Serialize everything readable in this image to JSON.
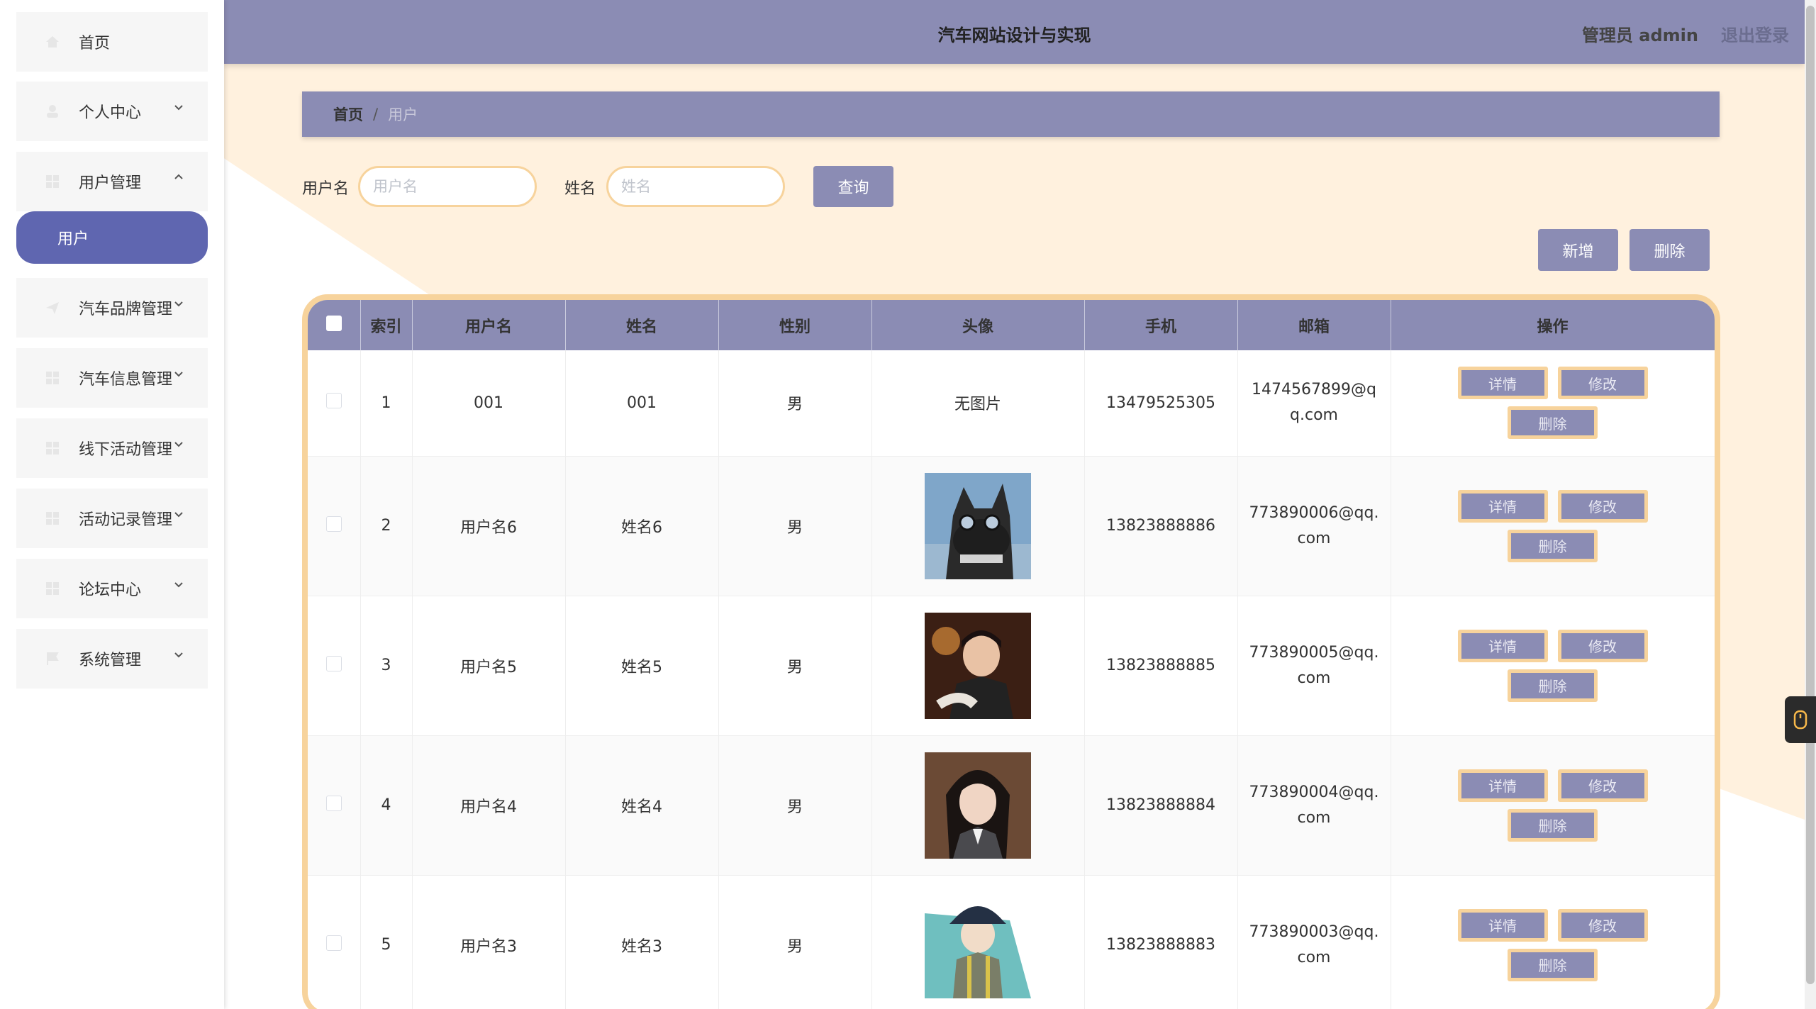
{
  "header": {
    "title": "汽车网站设计与实现",
    "admin": "管理员 admin",
    "logout": "退出登录"
  },
  "sidebar": {
    "items": [
      {
        "label": "首页",
        "icon": "home-icon"
      },
      {
        "label": "个人中心",
        "icon": "user-icon"
      },
      {
        "label": "用户管理",
        "icon": "grid-icon"
      },
      {
        "label": "汽车品牌管理",
        "icon": "send-icon"
      },
      {
        "label": "汽车信息管理",
        "icon": "grid-icon"
      },
      {
        "label": "线下活动管理",
        "icon": "grid-icon"
      },
      {
        "label": "活动记录管理",
        "icon": "grid-icon"
      },
      {
        "label": "论坛中心",
        "icon": "grid-icon"
      },
      {
        "label": "系统管理",
        "icon": "flag-icon"
      }
    ],
    "active_sub": "用户"
  },
  "breadcrumb": {
    "home": "首页",
    "separator": "/",
    "current": "用户"
  },
  "search": {
    "username_label": "用户名",
    "username_placeholder": "用户名",
    "name_label": "姓名",
    "name_placeholder": "姓名",
    "query_button": "查询"
  },
  "actions": {
    "add": "新增",
    "delete": "删除"
  },
  "table": {
    "headers": [
      "索引",
      "用户名",
      "姓名",
      "性别",
      "头像",
      "手机",
      "邮箱",
      "操作"
    ],
    "rows": [
      {
        "index": "1",
        "username": "001",
        "name": "001",
        "gender": "男",
        "avatar": "无图片",
        "phone": "13479525305",
        "email": "1474567899@qq.com"
      },
      {
        "index": "2",
        "username": "用户名6",
        "name": "姓名6",
        "gender": "男",
        "avatar": "dog-photo",
        "phone": "13823888886",
        "email": "773890006@qq.com"
      },
      {
        "index": "3",
        "username": "用户名5",
        "name": "姓名5",
        "gender": "男",
        "avatar": "boy-photo",
        "phone": "13823888885",
        "email": "773890005@qq.com"
      },
      {
        "index": "4",
        "username": "用户名4",
        "name": "姓名4",
        "gender": "男",
        "avatar": "girl-photo",
        "phone": "13823888884",
        "email": "773890004@qq.com"
      },
      {
        "index": "5",
        "username": "用户名3",
        "name": "姓名3",
        "gender": "男",
        "avatar": "anime-photo",
        "phone": "13823888883",
        "email": "773890003@qq.com"
      }
    ],
    "op_labels": {
      "detail": "详情",
      "edit": "修改",
      "delete": "删除"
    }
  },
  "colors": {
    "accent": "#8b8cb4",
    "active": "#5f66b0",
    "border": "#f7d39c",
    "cream": "#fff1de"
  }
}
